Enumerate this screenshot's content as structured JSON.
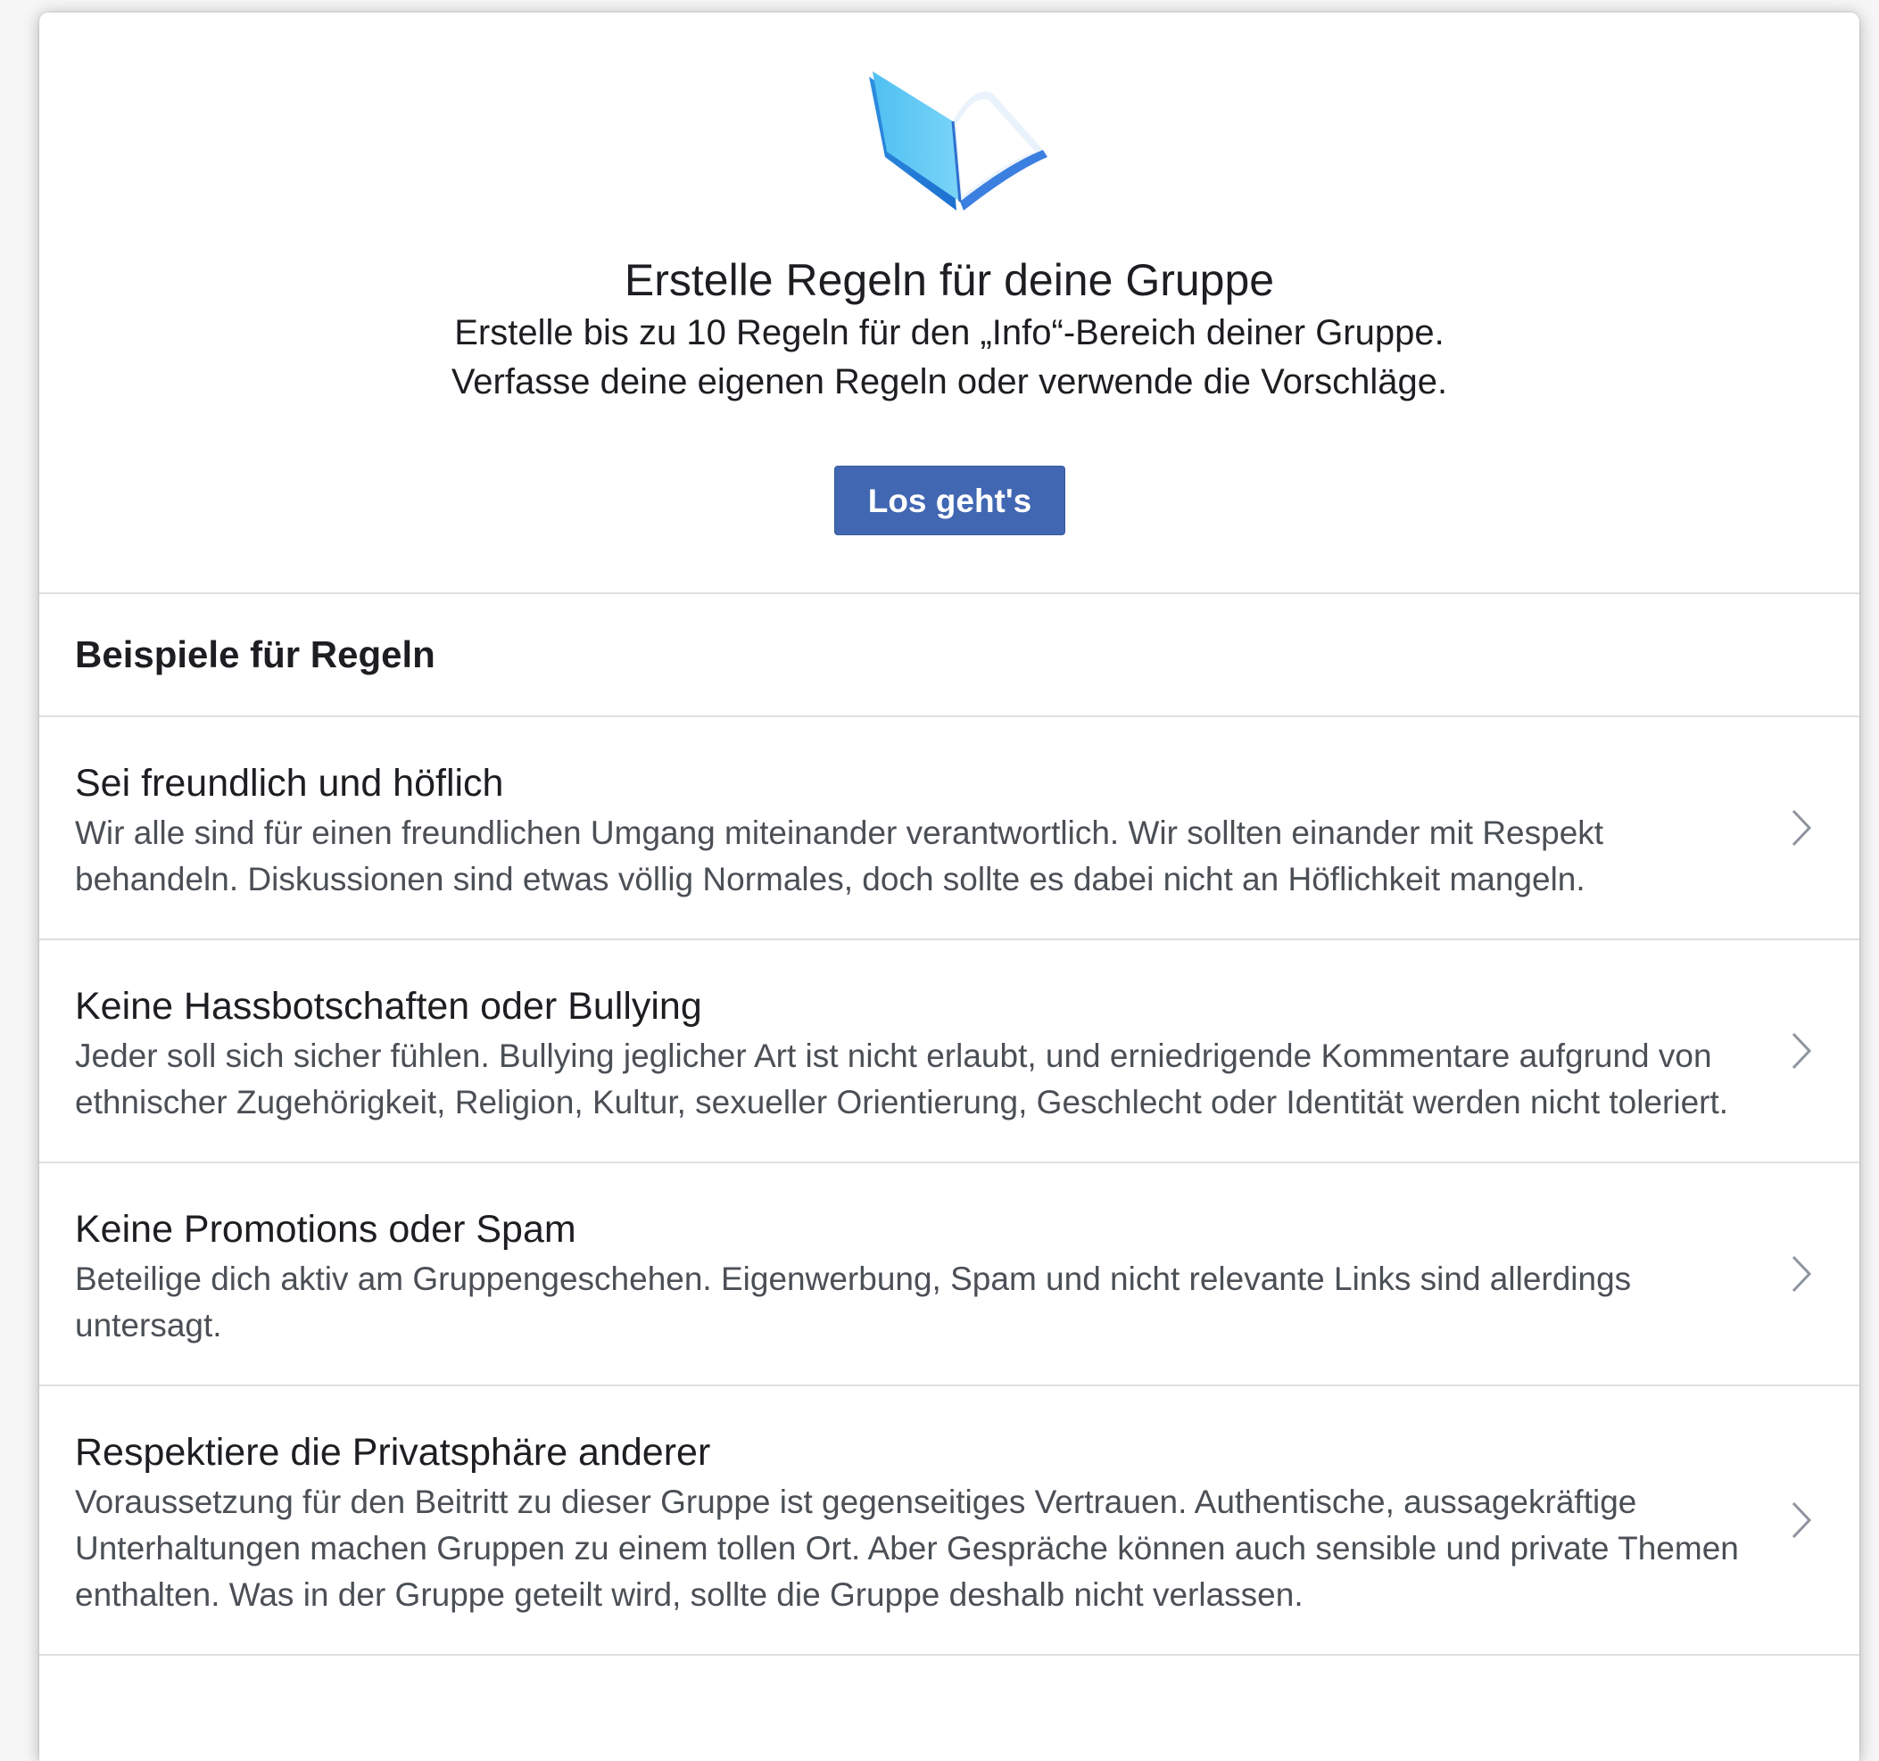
{
  "hero": {
    "icon": "book-icon",
    "title": "Erstelle Regeln für deine Gruppe",
    "subtitle": "Erstelle bis zu 10 Regeln für den „Info“-Bereich deiner Gruppe. Verfasse deine eigenen Regeln oder verwende die Vorschläge.",
    "button_label": "Los geht's"
  },
  "examples": {
    "heading": "Beispiele für Regeln",
    "rules": [
      {
        "title": "Sei freundlich und höflich",
        "description": "Wir alle sind für einen freundlichen Umgang miteinander verantwortlich. Wir sollten einander mit Respekt behandeln. Diskussionen sind etwas völlig Normales, doch sollte es dabei nicht an Höflichkeit mangeln."
      },
      {
        "title": "Keine Hassbotschaften oder Bullying",
        "description": "Jeder soll sich sicher fühlen. Bullying jeglicher Art ist nicht erlaubt, und erniedrigende Kommentare aufgrund von ethnischer Zugehörigkeit, Religion, Kultur, sexueller Orientierung, Geschlecht oder Identität werden nicht toleriert."
      },
      {
        "title": "Keine Promotions oder Spam",
        "description": "Beteilige dich aktiv am Gruppengeschehen. Eigenwerbung, Spam und nicht relevante Links sind allerdings untersagt."
      },
      {
        "title": "Respektiere die Privatsphäre anderer",
        "description": "Voraussetzung für den Beitritt zu dieser Gruppe ist gegenseitiges Vertrauen. Authentische, aussagekräftige Unterhaltungen machen Gruppen zu einem tollen Ort. Aber Gespräche können auch sensible und private Themen enthalten. Was in der Gruppe geteilt wird, sollte die Gruppe deshalb nicht verlassen."
      }
    ]
  },
  "colors": {
    "button": "#4267b2",
    "divider": "#dddfe2",
    "text_primary": "#1c1e21",
    "text_secondary": "#4b4f56"
  }
}
